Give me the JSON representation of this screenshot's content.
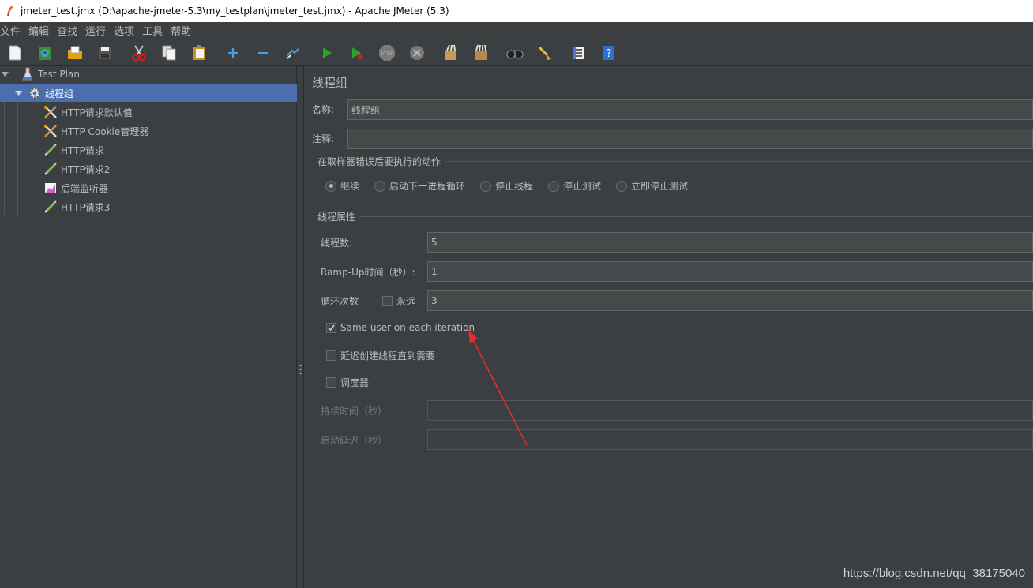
{
  "window": {
    "title": "jmeter_test.jmx (D:\\apache-jmeter-5.3\\my_testplan\\jmeter_test.jmx) - Apache JMeter (5.3)"
  },
  "menu": [
    "文件",
    "编辑",
    "查找",
    "运行",
    "选项",
    "工具",
    "帮助"
  ],
  "toolbar": {
    "icons": [
      "new-icon",
      "templates-icon",
      "open-icon",
      "save-icon",
      "cut-icon",
      "copy-icon",
      "paste-icon",
      "expand-icon",
      "collapse-icon",
      "toggle-icon",
      "start-icon",
      "start-no-pause-icon",
      "stop-icon",
      "shutdown-icon",
      "clear-icon",
      "clear-all-icon",
      "search-icon",
      "reset-search-icon",
      "function-helper-icon",
      "help-icon"
    ]
  },
  "tree": {
    "items": [
      {
        "label": "Test Plan",
        "icon": "test-plan-icon"
      },
      {
        "label": "线程组",
        "icon": "gear-icon"
      },
      {
        "label": "HTTP请求默认值",
        "icon": "config-tools-icon"
      },
      {
        "label": "HTTP Cookie管理器",
        "icon": "config-tools-icon"
      },
      {
        "label": "HTTP请求",
        "icon": "sampler-pen-icon"
      },
      {
        "label": "HTTP请求2",
        "icon": "sampler-pen-icon"
      },
      {
        "label": "后端监听器",
        "icon": "listener-chart-icon"
      },
      {
        "label": "HTTP请求3",
        "icon": "sampler-pen-icon"
      }
    ],
    "selected": "线程组"
  },
  "panel": {
    "heading": "线程组",
    "name_label": "名称:",
    "name_value": "线程组",
    "comment_label": "注释:",
    "comment_value": "",
    "error_action": {
      "title": "在取样器错误后要执行的动作",
      "options": [
        "继续",
        "启动下一进程循环",
        "停止线程",
        "停止测试",
        "立即停止测试"
      ],
      "selected": "继续"
    },
    "thread_props": {
      "title": "线程属性",
      "threads_label": "线程数:",
      "threads_value": "5",
      "rampup_label": "Ramp-Up时间（秒）:",
      "rampup_value": "1",
      "loop_label": "循环次数",
      "forever_label": "永远",
      "forever_checked": false,
      "loop_value": "3",
      "same_user_label": "Same user on each iteration",
      "same_user_checked": true,
      "delay_label": "延迟创建线程直到需要",
      "delay_checked": false,
      "scheduler_label": "调度器",
      "scheduler_checked": false,
      "duration_label": "持续时间（秒）",
      "duration_value": "",
      "startup_delay_label": "启动延迟（秒）",
      "startup_delay_value": ""
    }
  },
  "annotation": {
    "color": "#e03030"
  },
  "watermark": "https://blog.csdn.net/qq_38175040"
}
